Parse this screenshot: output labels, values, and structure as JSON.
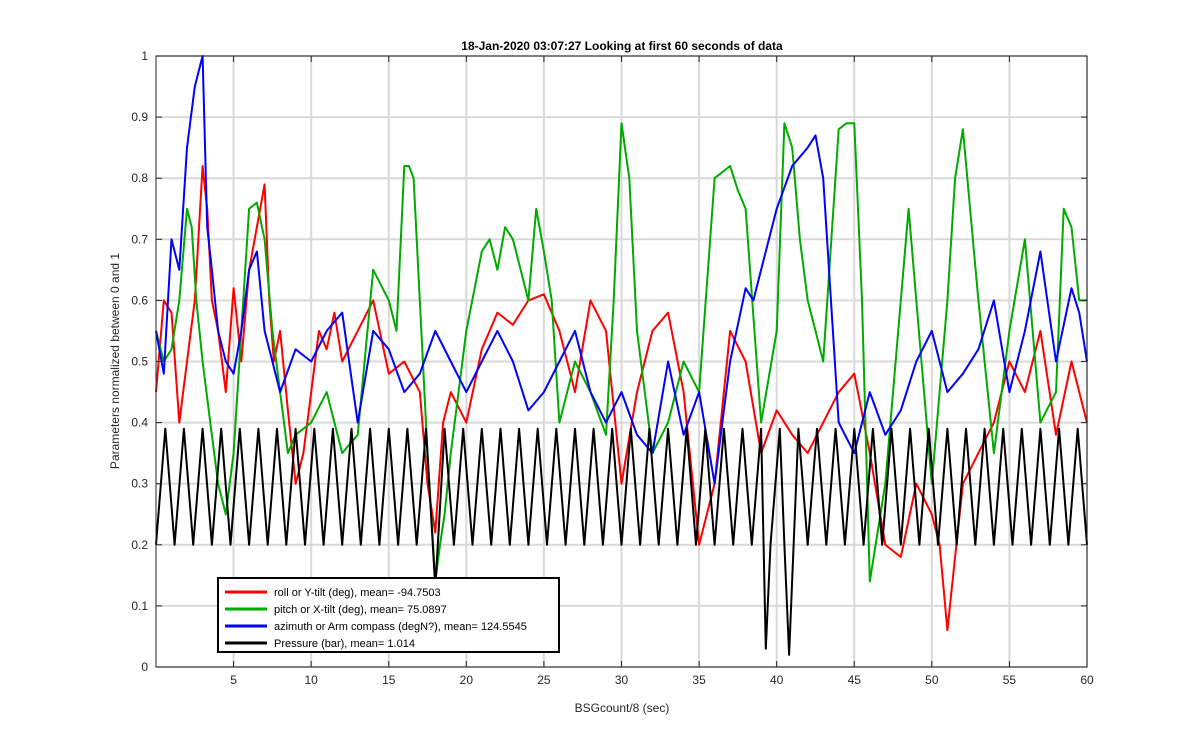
{
  "chart_data": {
    "type": "line",
    "title": "18-Jan-2020 03:07:27 Looking at first 60 seconds of data",
    "xlabel": "BSGcount/8 (sec)",
    "ylabel": "Parameters normalized between 0 and 1",
    "xlim": [
      0,
      60
    ],
    "ylim": [
      0,
      1
    ],
    "xticks": [
      5,
      10,
      15,
      20,
      25,
      30,
      35,
      40,
      45,
      50,
      55,
      60
    ],
    "yticks": [
      0,
      0.1,
      0.2,
      0.3,
      0.4,
      0.5,
      0.6,
      0.7,
      0.8,
      0.9,
      1
    ],
    "ytick_labels": [
      "0",
      "0.1",
      "0.2",
      "0.3",
      "0.4",
      "0.5",
      "0.6",
      "0.7",
      "0.8",
      "0.9",
      "1"
    ],
    "grid": true,
    "legend_position": "bottom-left",
    "series": [
      {
        "name": "roll or Y-tilt (deg), mean= -94.7503",
        "color": "#ff0000",
        "x": [
          0,
          0.5,
          1,
          1.5,
          2,
          2.5,
          3,
          3.3,
          3.6,
          4,
          4.5,
          5,
          5.5,
          6,
          6.5,
          7,
          7.3,
          7.6,
          8,
          8.5,
          9,
          9.5,
          10,
          10.5,
          11,
          11.5,
          12,
          13,
          14,
          15,
          16,
          17,
          17.5,
          18,
          18.5,
          19,
          20,
          21,
          22,
          23,
          24,
          25,
          26,
          27,
          28,
          29,
          30,
          31,
          32,
          33,
          34,
          35,
          36,
          37,
          38,
          39,
          40,
          41,
          42,
          43,
          44,
          45,
          46,
          47,
          48,
          49,
          50,
          50.5,
          51,
          51.5,
          52,
          53,
          54,
          55,
          56,
          57,
          58,
          59,
          60
        ],
        "values": [
          0.45,
          0.6,
          0.58,
          0.4,
          0.5,
          0.6,
          0.82,
          0.75,
          0.6,
          0.55,
          0.45,
          0.62,
          0.5,
          0.65,
          0.72,
          0.79,
          0.6,
          0.5,
          0.55,
          0.42,
          0.3,
          0.35,
          0.45,
          0.55,
          0.52,
          0.58,
          0.5,
          0.55,
          0.6,
          0.48,
          0.5,
          0.45,
          0.3,
          0.22,
          0.4,
          0.45,
          0.4,
          0.52,
          0.58,
          0.56,
          0.6,
          0.61,
          0.55,
          0.45,
          0.6,
          0.55,
          0.3,
          0.45,
          0.55,
          0.58,
          0.45,
          0.2,
          0.3,
          0.55,
          0.5,
          0.35,
          0.42,
          0.38,
          0.35,
          0.4,
          0.45,
          0.48,
          0.35,
          0.2,
          0.18,
          0.3,
          0.25,
          0.2,
          0.06,
          0.18,
          0.3,
          0.35,
          0.4,
          0.5,
          0.45,
          0.55,
          0.38,
          0.5,
          0.4
        ]
      },
      {
        "name": "pitch or X-tilt (deg), mean= 75.0897",
        "color": "#00aa00",
        "x": [
          0,
          0.5,
          1,
          1.5,
          2,
          2.3,
          2.6,
          3,
          3.5,
          4,
          4.5,
          5,
          5.5,
          6,
          6.5,
          7,
          7.5,
          8,
          8.5,
          9,
          10,
          11,
          12,
          13,
          14,
          15,
          15.5,
          16,
          16.3,
          16.6,
          17,
          17.5,
          18,
          18.3,
          18.6,
          19,
          20,
          21,
          21.5,
          22,
          22.5,
          23,
          24,
          24.5,
          25,
          25.5,
          26,
          27,
          28,
          29,
          29.5,
          30,
          30.5,
          31,
          32,
          33,
          34,
          35,
          36,
          37,
          37.5,
          38,
          39,
          40,
          40.5,
          41,
          41.5,
          42,
          42.5,
          43,
          44,
          44.5,
          45,
          45.5,
          46,
          47,
          48,
          48.5,
          49,
          50,
          50.5,
          51,
          51.5,
          52,
          53,
          54,
          55,
          56,
          57,
          58,
          58.5,
          59,
          59.5,
          60
        ],
        "values": [
          0.55,
          0.5,
          0.52,
          0.6,
          0.75,
          0.72,
          0.6,
          0.5,
          0.4,
          0.3,
          0.25,
          0.35,
          0.55,
          0.75,
          0.76,
          0.7,
          0.55,
          0.45,
          0.35,
          0.38,
          0.4,
          0.45,
          0.35,
          0.38,
          0.65,
          0.6,
          0.55,
          0.82,
          0.82,
          0.8,
          0.6,
          0.35,
          0.14,
          0.2,
          0.25,
          0.35,
          0.55,
          0.68,
          0.7,
          0.65,
          0.72,
          0.7,
          0.6,
          0.75,
          0.68,
          0.6,
          0.4,
          0.5,
          0.45,
          0.38,
          0.6,
          0.89,
          0.8,
          0.55,
          0.35,
          0.4,
          0.5,
          0.45,
          0.8,
          0.82,
          0.78,
          0.75,
          0.4,
          0.55,
          0.89,
          0.85,
          0.7,
          0.6,
          0.55,
          0.5,
          0.88,
          0.89,
          0.89,
          0.6,
          0.14,
          0.3,
          0.6,
          0.75,
          0.6,
          0.3,
          0.45,
          0.6,
          0.8,
          0.88,
          0.6,
          0.35,
          0.55,
          0.7,
          0.4,
          0.45,
          0.75,
          0.72,
          0.6,
          0.6
        ]
      },
      {
        "name": "azimuth or Arm compass (degN?), mean= 124.5545",
        "color": "#0000ff",
        "x": [
          0,
          0.5,
          1,
          1.5,
          2,
          2.5,
          3,
          3.3,
          3.6,
          4,
          4.5,
          5,
          5.5,
          6,
          6.5,
          7,
          7.5,
          8,
          9,
          10,
          11,
          12,
          13,
          14,
          15,
          16,
          17,
          18,
          19,
          20,
          21,
          22,
          23,
          24,
          25,
          26,
          27,
          28,
          29,
          30,
          31,
          32,
          33,
          34,
          35,
          36,
          37,
          38,
          38.5,
          39,
          40,
          41,
          42,
          42.5,
          43,
          44,
          45,
          46,
          47,
          48,
          49,
          50,
          51,
          52,
          53,
          54,
          55,
          56,
          57,
          58,
          59,
          59.5,
          60
        ],
        "values": [
          0.55,
          0.48,
          0.7,
          0.65,
          0.85,
          0.95,
          1.0,
          0.72,
          0.65,
          0.55,
          0.5,
          0.48,
          0.55,
          0.65,
          0.68,
          0.55,
          0.5,
          0.45,
          0.52,
          0.5,
          0.55,
          0.58,
          0.4,
          0.55,
          0.52,
          0.45,
          0.48,
          0.55,
          0.5,
          0.45,
          0.5,
          0.55,
          0.5,
          0.42,
          0.45,
          0.5,
          0.55,
          0.45,
          0.4,
          0.45,
          0.38,
          0.35,
          0.5,
          0.38,
          0.45,
          0.3,
          0.5,
          0.62,
          0.6,
          0.65,
          0.75,
          0.82,
          0.85,
          0.87,
          0.8,
          0.4,
          0.35,
          0.45,
          0.38,
          0.42,
          0.5,
          0.55,
          0.45,
          0.48,
          0.52,
          0.6,
          0.45,
          0.55,
          0.68,
          0.5,
          0.62,
          0.58,
          0.5
        ]
      },
      {
        "name": "Pressure (bar), mean= 1.014",
        "color": "#000000",
        "x": [
          0,
          0.6,
          1.2,
          1.8,
          2.4,
          3,
          3.6,
          4.2,
          4.8,
          5.4,
          6,
          6.6,
          7.2,
          7.8,
          8.4,
          9,
          9.6,
          10.2,
          10.8,
          11.4,
          12,
          12.6,
          13.2,
          13.8,
          14.4,
          15,
          15.6,
          16.2,
          16.8,
          17.4,
          18,
          18.6,
          19.2,
          19.8,
          20.4,
          21,
          21.6,
          22.2,
          22.8,
          23.4,
          24,
          24.6,
          25.2,
          25.8,
          26.4,
          27,
          27.6,
          28.2,
          28.8,
          29.4,
          30,
          30.6,
          31.2,
          31.8,
          32.4,
          33,
          33.6,
          34.2,
          34.8,
          35.4,
          36,
          36.6,
          37.2,
          37.8,
          38.4,
          39,
          39.3,
          39.6,
          40.2,
          40.5,
          40.8,
          41.4,
          42,
          42.6,
          43.2,
          43.8,
          44.4,
          45,
          45.6,
          46.2,
          46.8,
          47.4,
          48,
          48.6,
          49.2,
          49.8,
          50.4,
          51,
          51.6,
          52.2,
          52.8,
          53.4,
          54,
          54.6,
          55.2,
          55.8,
          56.4,
          57,
          57.6,
          58.2,
          58.8,
          59.4,
          60
        ],
        "values": [
          0.2,
          0.39,
          0.2,
          0.39,
          0.2,
          0.39,
          0.2,
          0.39,
          0.2,
          0.39,
          0.2,
          0.39,
          0.2,
          0.39,
          0.2,
          0.39,
          0.2,
          0.39,
          0.2,
          0.39,
          0.2,
          0.39,
          0.2,
          0.39,
          0.2,
          0.39,
          0.2,
          0.39,
          0.2,
          0.39,
          0.13,
          0.39,
          0.2,
          0.39,
          0.2,
          0.39,
          0.2,
          0.39,
          0.2,
          0.39,
          0.2,
          0.39,
          0.2,
          0.39,
          0.2,
          0.39,
          0.2,
          0.39,
          0.2,
          0.39,
          0.2,
          0.39,
          0.2,
          0.39,
          0.2,
          0.39,
          0.2,
          0.39,
          0.2,
          0.39,
          0.2,
          0.39,
          0.2,
          0.39,
          0.2,
          0.39,
          0.03,
          0.2,
          0.39,
          0.2,
          0.02,
          0.39,
          0.2,
          0.39,
          0.2,
          0.39,
          0.2,
          0.39,
          0.2,
          0.39,
          0.2,
          0.39,
          0.2,
          0.39,
          0.2,
          0.39,
          0.2,
          0.39,
          0.2,
          0.39,
          0.2,
          0.39,
          0.2,
          0.39,
          0.2,
          0.39,
          0.2,
          0.39,
          0.2,
          0.39,
          0.2,
          0.39,
          0.2
        ]
      }
    ]
  }
}
